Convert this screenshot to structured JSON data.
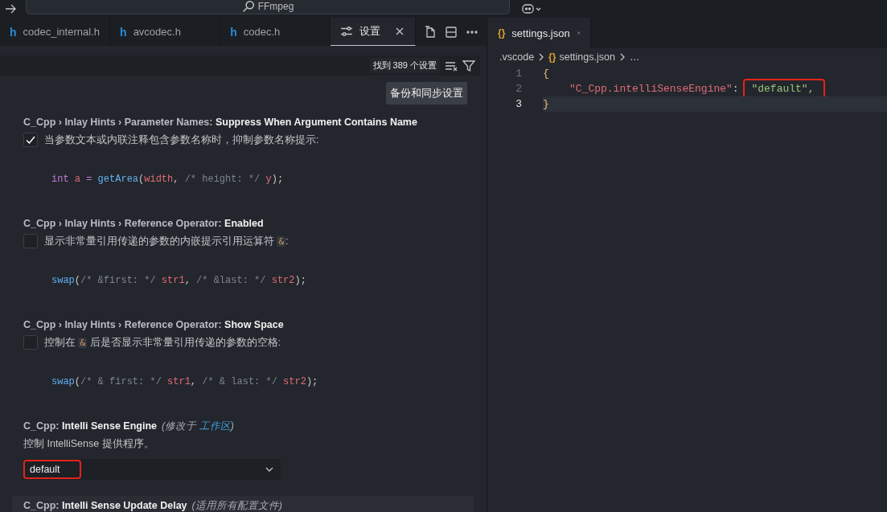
{
  "title_bar": {
    "search": "FFmpeg"
  },
  "left_tabs": [
    {
      "label": "codec_internal.h",
      "kind": "header",
      "icon": "h",
      "selected": false
    },
    {
      "label": "avcodec.h",
      "kind": "header",
      "icon": "h",
      "selected": false
    },
    {
      "label": "codec.h",
      "kind": "header",
      "icon": "h",
      "selected": false
    },
    {
      "label": "设置",
      "kind": "settings",
      "selected": true
    }
  ],
  "settings": {
    "result_count": "找到 389 个设置",
    "sync_button": "备份和同步设置",
    "items": [
      {
        "kind": "checkbox",
        "category": "C_Cpp › Inlay Hints › Parameter Names: ",
        "name": "Suppress When Argument Contains Name",
        "checked": true,
        "description": [
          {
            "kind": "text",
            "text": "当参数文本或内联注释包含参数名称时，抑制参数名称提示:"
          }
        ],
        "code": [
          {
            "kind": "keyword",
            "text": "int"
          },
          {
            "kind": "variable",
            "text": " a"
          },
          {
            "kind": "keyword",
            "text": " ="
          },
          {
            "kind": "function",
            "text": " getArea"
          },
          {
            "kind": "punct",
            "text": "("
          },
          {
            "kind": "variable",
            "text": "width"
          },
          {
            "kind": "punct",
            "text": ", "
          },
          {
            "kind": "comment",
            "text": "/* height: */ "
          },
          {
            "kind": "variable",
            "text": "y"
          },
          {
            "kind": "punct",
            "text": ");"
          }
        ]
      },
      {
        "kind": "checkbox",
        "category": "C_Cpp › Inlay Hints › Reference Operator: ",
        "name": "Enabled",
        "checked": false,
        "description": [
          {
            "kind": "text",
            "text": "显示非常量引用传递的参数的内嵌提示引用运算符 "
          },
          {
            "kind": "code",
            "text": "&"
          },
          {
            "kind": "text",
            "text": ":"
          }
        ],
        "code": [
          {
            "kind": "function",
            "text": "swap"
          },
          {
            "kind": "punct",
            "text": "("
          },
          {
            "kind": "comment",
            "text": "/* &first: */ "
          },
          {
            "kind": "variable",
            "text": "str1"
          },
          {
            "kind": "punct",
            "text": ", "
          },
          {
            "kind": "comment",
            "text": "/* &last: */ "
          },
          {
            "kind": "variable",
            "text": "str2"
          },
          {
            "kind": "punct",
            "text": ");"
          }
        ]
      },
      {
        "kind": "checkbox",
        "category": "C_Cpp › Inlay Hints › Reference Operator: ",
        "name": "Show Space",
        "checked": false,
        "description": [
          {
            "kind": "text",
            "text": "控制在 "
          },
          {
            "kind": "code",
            "text": "&"
          },
          {
            "kind": "text",
            "text": " 后是否显示非常量引用传递的参数的空格:"
          }
        ],
        "code": [
          {
            "kind": "function",
            "text": "swap"
          },
          {
            "kind": "punct",
            "text": "("
          },
          {
            "kind": "comment",
            "text": "/* & first: */ "
          },
          {
            "kind": "variable",
            "text": "str1"
          },
          {
            "kind": "punct",
            "text": ", "
          },
          {
            "kind": "comment",
            "text": "/* & last: */ "
          },
          {
            "kind": "variable",
            "text": "str2"
          },
          {
            "kind": "punct",
            "text": ");"
          }
        ]
      },
      {
        "kind": "dropdown",
        "category": "C_Cpp: ",
        "name": "Intelli Sense Engine",
        "note": "(修改于 ",
        "note_link": "工作区",
        "note_end": ")",
        "description": [
          {
            "kind": "text",
            "text": "控制 IntelliSense 提供程序。"
          }
        ],
        "value": "default",
        "highlighted": true
      },
      {
        "kind": "heading",
        "category": "C_Cpp: ",
        "name": "Intelli Sense Update Delay",
        "note": "(适用所有配置文件)",
        "hovered": true
      }
    ]
  },
  "right_tab": {
    "icon": "{}",
    "label": "settings.json",
    "selected": true
  },
  "breadcrumb": [
    {
      "kind": "folder",
      "text": ".vscode"
    },
    {
      "kind": "json",
      "icon": "{}",
      "text": "settings.json"
    },
    {
      "kind": "more",
      "text": "…"
    }
  ],
  "editor": {
    "lines": [
      {
        "number": "1",
        "current": false,
        "tokens": [
          {
            "kind": "brace",
            "text": "{"
          }
        ]
      },
      {
        "number": "2",
        "current": false,
        "tokens": [
          {
            "kind": "key",
            "text": "\"C_Cpp.intelliSenseEngine\""
          },
          {
            "kind": "punct",
            "text": ": "
          },
          {
            "kind": "string",
            "text": "\"default\",",
            "highlighted": true
          }
        ]
      },
      {
        "number": "3",
        "current": true,
        "tokens": [
          {
            "kind": "brace",
            "text": "}"
          }
        ]
      }
    ]
  }
}
